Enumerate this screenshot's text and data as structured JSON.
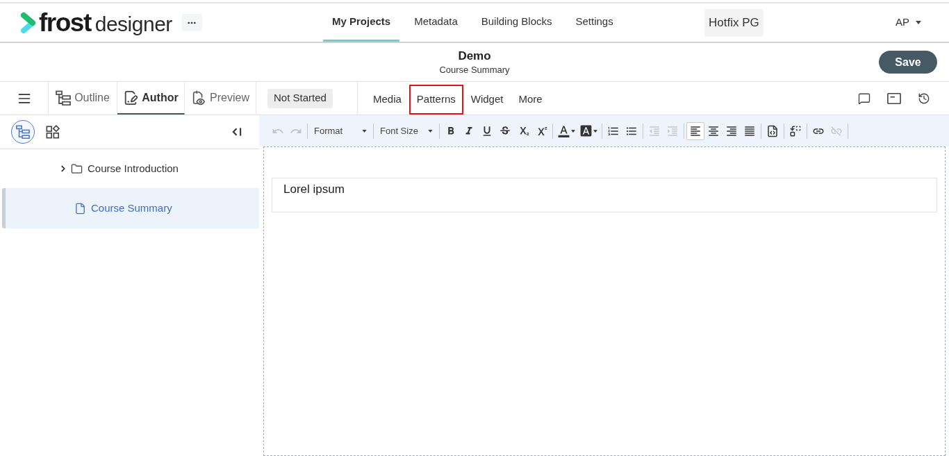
{
  "topbar": {
    "logo": {
      "bold": "frost",
      "light": "designer"
    },
    "nav": [
      {
        "label": "My Projects",
        "selected": true
      },
      {
        "label": "Metadata",
        "selected": false
      },
      {
        "label": "Building Blocks",
        "selected": false
      },
      {
        "label": "Settings",
        "selected": false
      }
    ],
    "workspace": "Hotfix PG",
    "user": "AP"
  },
  "header": {
    "title": "Demo",
    "subtitle": "Course Summary",
    "save": "Save"
  },
  "modebar": {
    "tabs": [
      {
        "label": "Outline",
        "selected": false
      },
      {
        "label": "Author",
        "selected": true
      },
      {
        "label": "Preview",
        "selected": false
      }
    ],
    "status": "Not Started",
    "menu": [
      {
        "label": "Media",
        "highlighted": false
      },
      {
        "label": "Patterns",
        "highlighted": true
      },
      {
        "label": "Widget",
        "highlighted": false
      },
      {
        "label": "More",
        "highlighted": false
      }
    ]
  },
  "sidebar": {
    "views": [
      {
        "selected": true
      },
      {
        "selected": false
      }
    ],
    "tree": [
      {
        "label": "Course Introduction",
        "kind": "folder",
        "expanded": false,
        "selected": false
      },
      {
        "label": "Course Summary",
        "kind": "page",
        "selected": true
      }
    ]
  },
  "toolbar": {
    "groups": [
      [
        {
          "kind": "button",
          "disabled": true
        },
        {
          "kind": "button",
          "disabled": true
        }
      ],
      [
        {
          "kind": "select",
          "label": "Format"
        }
      ],
      [
        {
          "kind": "select",
          "label": "Font Size"
        }
      ],
      [
        {
          "kind": "button",
          "disabled": false
        },
        {
          "kind": "button",
          "disabled": false
        },
        {
          "kind": "button",
          "disabled": false
        },
        {
          "kind": "button",
          "disabled": false
        },
        {
          "kind": "button",
          "disabled": false
        },
        {
          "kind": "button",
          "disabled": false
        }
      ],
      [
        {
          "kind": "menu",
          "disabled": false
        },
        {
          "kind": "menu",
          "disabled": false
        }
      ],
      [
        {
          "kind": "button",
          "disabled": false
        },
        {
          "kind": "button",
          "disabled": false
        }
      ],
      [
        {
          "kind": "button",
          "disabled": true
        },
        {
          "kind": "button",
          "disabled": true
        }
      ],
      [
        {
          "kind": "button",
          "disabled": false,
          "selected": true
        },
        {
          "kind": "button",
          "disabled": false,
          "selected": false
        },
        {
          "kind": "button",
          "disabled": false,
          "selected": false
        },
        {
          "kind": "button",
          "disabled": false,
          "selected": false
        }
      ],
      [
        {
          "kind": "button",
          "disabled": false
        }
      ],
      [
        {
          "kind": "button",
          "disabled": false
        }
      ],
      [
        {
          "kind": "button",
          "disabled": false
        },
        {
          "kind": "button",
          "disabled": true
        }
      ]
    ]
  },
  "editor": {
    "blocks": [
      {
        "text": "Lorel ipsum"
      }
    ]
  }
}
